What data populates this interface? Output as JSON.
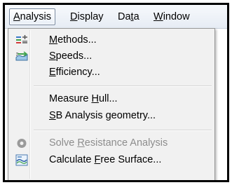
{
  "menubar": {
    "items": [
      {
        "label_pre": "",
        "label_u": "A",
        "label_post": "nalysis",
        "active": true
      },
      {
        "label_pre": "",
        "label_u": "D",
        "label_post": "isplay"
      },
      {
        "label_pre": "Da",
        "label_u": "t",
        "label_post": "a"
      },
      {
        "label_pre": "",
        "label_u": "W",
        "label_post": "indow"
      }
    ]
  },
  "menu": {
    "methods": {
      "u": "M",
      "rest": "ethods...",
      "icon": "methods-icon"
    },
    "speeds": {
      "u": "S",
      "rest": "peeds...",
      "icon": "speeds-icon"
    },
    "efficiency": {
      "u": "E",
      "rest": "fficiency..."
    },
    "measure_hull": {
      "pre": "Measure ",
      "u": "H",
      "rest": "ull..."
    },
    "sb_geometry": {
      "u": "S",
      "rest": "B Analysis geometry..."
    },
    "solve": {
      "pre": "Solve ",
      "u": "R",
      "rest": "esistance Analysis",
      "disabled": true,
      "icon": "solve-gear-icon"
    },
    "free_surface": {
      "pre": "Calculate ",
      "u": "F",
      "rest": "ree Surface...",
      "icon": "free-surface-icon"
    }
  }
}
